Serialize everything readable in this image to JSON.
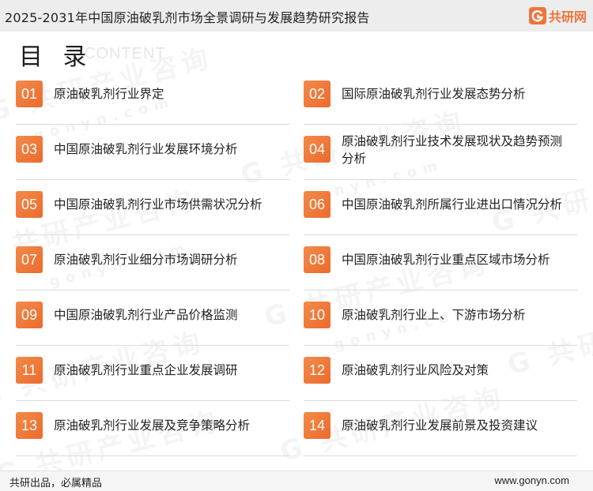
{
  "header": {
    "title": "2025-2031年中国原油破乳剂市场全景调研与发展趋势研究报告",
    "brand_name": "共研网",
    "brand_icon": "gonyn-logo-icon"
  },
  "toc": {
    "title": "目 录",
    "subtitle": "CONTENT",
    "items": [
      {
        "num": "01",
        "label": "原油破乳剂行业界定"
      },
      {
        "num": "02",
        "label": "国际原油破乳剂行业发展态势分析"
      },
      {
        "num": "03",
        "label": "中国原油破乳剂行业发展环境分析"
      },
      {
        "num": "04",
        "label": "原油破乳剂行业技术发展现状及趋势预测分析"
      },
      {
        "num": "05",
        "label": "中国原油破乳剂行业市场供需状况分析"
      },
      {
        "num": "06",
        "label": "中国原油破乳剂所属行业进出口情况分析"
      },
      {
        "num": "07",
        "label": "原油破乳剂行业细分市场调研分析"
      },
      {
        "num": "08",
        "label": "中国原油破乳剂行业重点区域市场分析"
      },
      {
        "num": "09",
        "label": "中国原油破乳剂行业产品价格监测"
      },
      {
        "num": "10",
        "label": "原油破乳剂行业上、下游市场分析"
      },
      {
        "num": "11",
        "label": "原油破乳剂行业重点企业发展调研"
      },
      {
        "num": "12",
        "label": "原油破乳剂行业风险及对策"
      },
      {
        "num": "13",
        "label": "原油破乳剂行业发展及竞争策略分析"
      },
      {
        "num": "14",
        "label": "原油破乳剂行业发展前景及投资建议"
      }
    ]
  },
  "footer": {
    "slogan": "共研出品，必属精品",
    "website": "www.gonyn.com"
  },
  "colors": {
    "accent": "#ec6a2c",
    "header_bg": "#ededed",
    "footer_bg": "#f5f5f5"
  }
}
